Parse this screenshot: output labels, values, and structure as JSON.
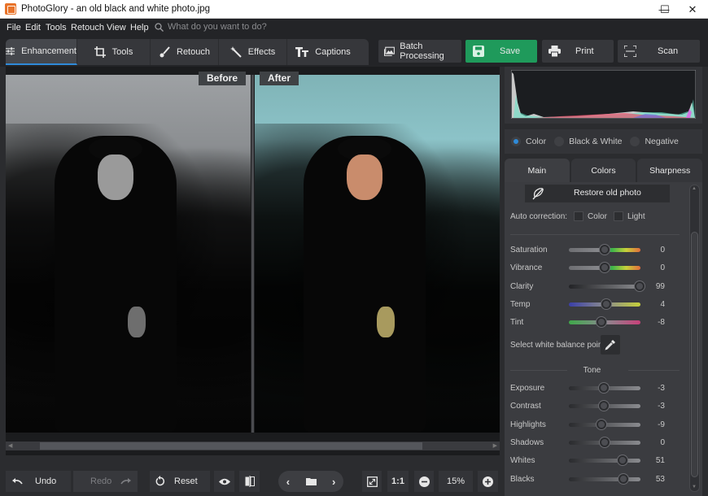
{
  "window": {
    "title": "PhotoGlory - an old black and white photo.jpg",
    "controls": {
      "minimize": "—",
      "maximize": "☐",
      "close": "✕"
    }
  },
  "menu": {
    "items": [
      "File",
      "Edit",
      "Tools",
      "Retouch",
      "View",
      "Help"
    ],
    "search_placeholder": "What do you want to do?"
  },
  "toolbar": {
    "tabs": [
      {
        "label": "Enhancement",
        "icon": "sliders-icon",
        "active": true
      },
      {
        "label": "Tools",
        "icon": "crop-icon",
        "active": false
      },
      {
        "label": "Retouch",
        "icon": "brush-icon",
        "active": false
      },
      {
        "label": "Effects",
        "icon": "magic-wand-icon",
        "active": false
      },
      {
        "label": "Captions",
        "icon": "text-icon",
        "active": false
      }
    ],
    "batch_label": "Batch Processing",
    "save_label": "Save",
    "print_label": "Print",
    "scan_label": "Scan"
  },
  "canvas": {
    "before_label": "Before",
    "after_label": "After"
  },
  "bottombar": {
    "undo_label": "Undo",
    "redo_label": "Redo",
    "reset_label": "Reset",
    "actual_size_label": "1:1",
    "zoom_value": "15%"
  },
  "panel": {
    "modes": [
      {
        "label": "Color",
        "selected": true
      },
      {
        "label": "Black & White",
        "selected": false
      },
      {
        "label": "Negative",
        "selected": false
      }
    ],
    "tabs": [
      {
        "label": "Main",
        "active": true
      },
      {
        "label": "Colors",
        "active": false
      },
      {
        "label": "Sharpness",
        "active": false
      }
    ],
    "restore_label": "Restore old photo",
    "auto_correction": {
      "label": "Auto correction:",
      "color_label": "Color",
      "light_label": "Light"
    },
    "color_sliders": [
      {
        "label": "Saturation",
        "value": "0",
        "fraction": 0.5
      },
      {
        "label": "Vibrance",
        "value": "0",
        "fraction": 0.5
      },
      {
        "label": "Clarity",
        "value": "99",
        "fraction": 0.99
      },
      {
        "label": "Temp",
        "value": "4",
        "fraction": 0.52
      },
      {
        "label": "Tint",
        "value": "-8",
        "fraction": 0.46
      }
    ],
    "white_balance_label": "Select white balance point",
    "tone_title": "Tone",
    "tone_sliders": [
      {
        "label": "Exposure",
        "value": "-3",
        "fraction": 0.485
      },
      {
        "label": "Contrast",
        "value": "-3",
        "fraction": 0.485
      },
      {
        "label": "Highlights",
        "value": "-9",
        "fraction": 0.455
      },
      {
        "label": "Shadows",
        "value": "0",
        "fraction": 0.5
      },
      {
        "label": "Whites",
        "value": "51",
        "fraction": 0.755
      },
      {
        "label": "Blacks",
        "value": "53",
        "fraction": 0.765
      }
    ]
  },
  "colors": {
    "accent": "#2f8ad8",
    "save": "#1f9a5b"
  }
}
